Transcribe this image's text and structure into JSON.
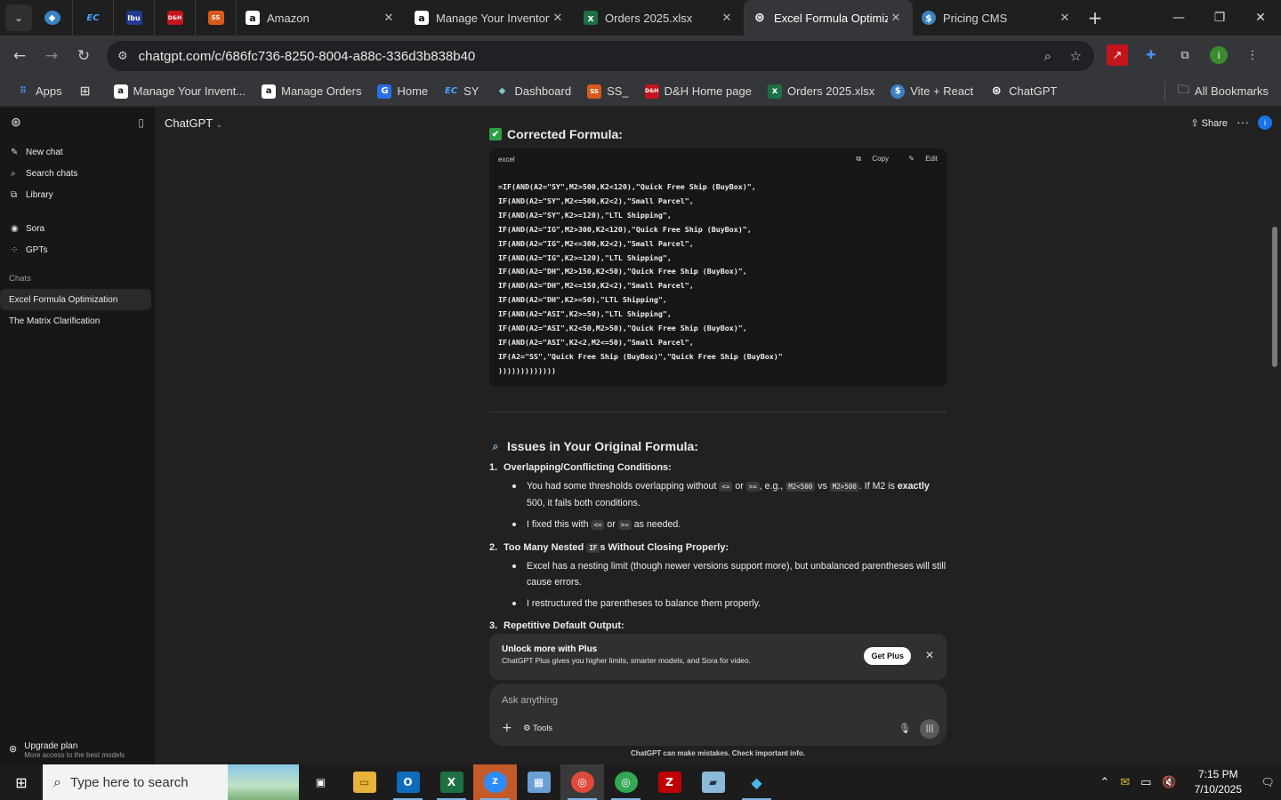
{
  "browser": {
    "tabs": [
      {
        "title": "Amazon",
        "icon": "amazon-icon"
      },
      {
        "title": "Manage Your Inventory",
        "icon": "amazon-icon"
      },
      {
        "title": "Orders 2025.xlsx",
        "icon": "excel-icon"
      },
      {
        "title": "Excel Formula Optimiz",
        "icon": "chatgpt-icon",
        "active": true
      },
      {
        "title": "Pricing CMS",
        "icon": "dollar-icon"
      }
    ],
    "pinned": [
      "EC",
      "Ibu",
      "D&H",
      "SS"
    ],
    "url": "chatgpt.com/c/686fc736-8250-8004-a88c-336d3b838b40",
    "bookmarks": [
      "Apps",
      "Manage Your Invent...",
      "Manage Orders",
      "Home",
      "SY",
      "Dashboard",
      "SS_",
      "D&H Home page",
      "Orders 2025.xlsx",
      "Vite + React",
      "ChatGPT"
    ],
    "all_bookmarks": "All Bookmarks",
    "avatar_letter": "i"
  },
  "sidebar": {
    "items": [
      "New chat",
      "Search chats",
      "Library"
    ],
    "items2": [
      "Sora",
      "GPTs"
    ],
    "chats_label": "Chats",
    "chats": [
      "Excel Formula Optimization",
      "The Matrix Clarification"
    ],
    "upgrade_title": "Upgrade plan",
    "upgrade_sub": "More access to the best models"
  },
  "header": {
    "model": "ChatGPT",
    "share": "Share"
  },
  "message": {
    "corrected_title": "Corrected Formula:",
    "code_lang": "excel",
    "copy": "Copy",
    "edit": "Edit",
    "code": "=IF(AND(A2=\"SY\",M2>500,K2<120),\"Quick Free Ship (BuyBox)\",\nIF(AND(A2=\"SY\",M2<=500,K2<2),\"Small Parcel\",\nIF(AND(A2=\"SY\",K2>=120),\"LTL Shipping\",\nIF(AND(A2=\"IG\",M2>300,K2<120),\"Quick Free Ship (BuyBox)\",\nIF(AND(A2=\"IG\",M2<=300,K2<2),\"Small Parcel\",\nIF(AND(A2=\"IG\",K2>=120),\"LTL Shipping\",\nIF(AND(A2=\"DH\",M2>150,K2<50),\"Quick Free Ship (BuyBox)\",\nIF(AND(A2=\"DH\",M2<=150,K2<2),\"Small Parcel\",\nIF(AND(A2=\"DH\",K2>=50),\"LTL Shipping\",\nIF(AND(A2=\"ASI\",K2>=50),\"LTL Shipping\",\nIF(AND(A2=\"ASI\",K2<50,M2>50),\"Quick Free Ship (BuyBox)\",\nIF(AND(A2=\"ASI\",K2<2,M2<=50),\"Small Parcel\",\nIF(A2=\"SS\",\"Quick Free Ship (BuyBox)\",\"Quick Free Ship (BuyBox)\"\n)))))))))))))",
    "issues_title": "Issues in Your Original Formula:",
    "issue1": "Overlapping/Conflicting Conditions:",
    "issue1_b1_a": "You had some thresholds overlapping without",
    "issue1_b1_c1": "<=",
    "issue1_b1_or": "or",
    "issue1_b1_c2": ">=",
    "issue1_b1_eg": ", e.g.,",
    "issue1_b1_c3": "M2<500",
    "issue1_b1_vs": "vs",
    "issue1_b1_c4": "M2>500",
    "issue1_b1_b": ". If M2 is",
    "issue1_b1_bold": "exactly",
    "issue1_b1_c": "500, it fails both conditions.",
    "issue1_b2_a": "I fixed this with",
    "issue1_b2_c1": "<=",
    "issue1_b2_or": "or",
    "issue1_b2_c2": ">=",
    "issue1_b2_b": "as needed.",
    "issue2_a": "Too Many Nested",
    "issue2_code": "IF",
    "issue2_b": "s Without Closing Properly:",
    "issue2_b1": "Excel has a nesting limit (though newer versions support more), but unbalanced parentheses will still cause errors.",
    "issue2_b2": "I restructured the parentheses to balance them properly.",
    "issue3": "Repetitive Default Output:"
  },
  "banner": {
    "title": "Unlock more with Plus",
    "desc": "ChatGPT Plus gives you higher limits, smarter models, and Sora for video.",
    "button": "Get Plus"
  },
  "composer": {
    "placeholder": "Ask anything",
    "tools": "Tools"
  },
  "disclaimer": "ChatGPT can make mistakes. Check important info.",
  "taskbar": {
    "search": "Type here to search",
    "time": "7:15 PM",
    "date": "7/10/2025"
  }
}
